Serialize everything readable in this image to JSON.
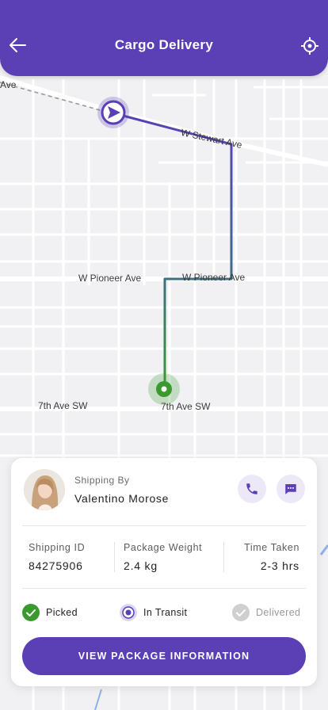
{
  "header": {
    "title": "Cargo Delivery",
    "back_icon": "arrow-left-icon",
    "locate_icon": "crosshair-icon"
  },
  "map": {
    "streets": {
      "stewart": "W Stewart Ave",
      "pioneer_left": "W Pioneer Ave",
      "pioneer_right": "W Pioneer Ave",
      "seventh_left": "7th Ave SW",
      "seventh_right": "7th Ave SW",
      "edge_fragment": "Ave"
    }
  },
  "shipment": {
    "shipping_by_label": "Shipping By",
    "courier_name": "Valentino Morose",
    "call_icon": "phone-icon",
    "message_icon": "chat-icon",
    "stats": {
      "id_label": "Shipping ID",
      "id_value": "84275906",
      "weight_label": "Package Weight",
      "weight_value": "2.4 kg",
      "time_label": "Time Taken",
      "time_value": "2-3 hrs"
    },
    "statuses": [
      {
        "label": "Picked",
        "state": "done"
      },
      {
        "label": "In Transit",
        "state": "current"
      },
      {
        "label": "Delivered",
        "state": "pending"
      }
    ],
    "cta_label": "VIEW PACKAGE INFORMATION"
  },
  "colors": {
    "primary": "#5a3fb5",
    "success": "#3a9a2e",
    "pending": "#c8c8c8",
    "route": "#5a3fb5"
  }
}
